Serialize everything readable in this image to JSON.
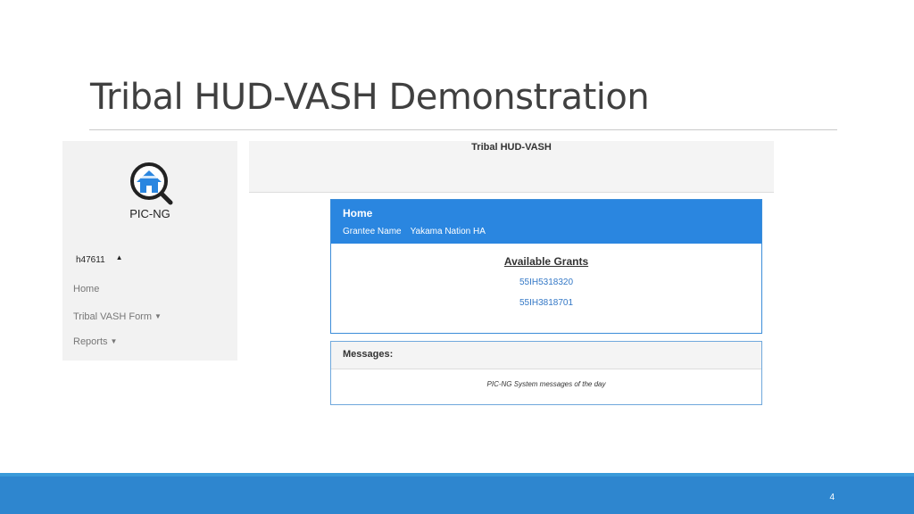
{
  "slide": {
    "title": "Tribal HUD-VASH Demonstration",
    "page_number": "4"
  },
  "nav": {
    "logo_label": "PIC-NG",
    "user": "h47611",
    "items": [
      {
        "label": "Home"
      },
      {
        "label": "Tribal VASH Form"
      },
      {
        "label": "Reports"
      }
    ]
  },
  "header": {
    "title": "Tribal HUD-VASH"
  },
  "home": {
    "title": "Home",
    "grantee_label": "Grantee Name",
    "grantee_value": "Yakama Nation HA",
    "available_grants_label": "Available Grants",
    "grants": [
      "55IH5318320",
      "55IH3818701"
    ]
  },
  "messages": {
    "title": "Messages:",
    "body": "PIC-NG System messages of the day"
  },
  "colors": {
    "accent_blue": "#2a86e0",
    "footer_blue": "#2e86cf",
    "link_blue": "#3478c6"
  }
}
